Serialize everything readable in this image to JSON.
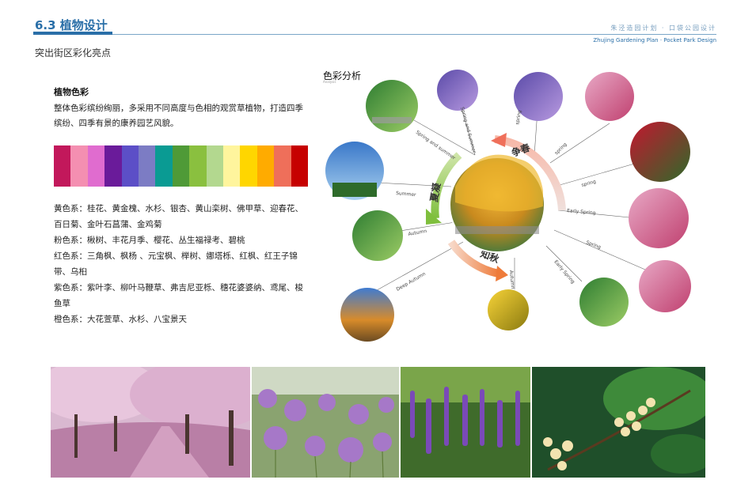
{
  "header": {
    "title": "6.3 植物设计",
    "brand_cn": "朱泾造园计划 · 口袋公园设计",
    "brand_en": "Zhujing Gardening Plan · Pocket Park Design"
  },
  "subtitle": "突出街区彩化亮点",
  "plant_color": {
    "heading": "植物色彩",
    "intro": "整体色彩缤纷绚丽，多采用不同高度与色相的观赏草植物，打造四季缤纷、四季有景的康养园艺风貌。",
    "swatches": [
      "#c2185b",
      "#f48fb1",
      "#e06ccf",
      "#6a1b9a",
      "#5c4fc7",
      "#7c7cc4",
      "#0a9b93",
      "#4f9a37",
      "#8ac03f",
      "#b3d88f",
      "#fff59d",
      "#ffd600",
      "#ffab00",
      "#ef6f5a",
      "#c60000"
    ]
  },
  "color_groups": [
    "黄色系：桂花、黄金槐、水杉、银杏、黄山栾树、佛甲草、迎春花、百日菊、金叶石菖蒲、金鸡菊",
    "粉色系：楸树、丰花月季、樱花、丛生福禄考、碧桃",
    "红色系：三角枫、枫杨 、元宝枫、榉树、娜塔栎、红枫、红王子锦带、乌桕",
    "紫色系：紫叶李、柳叶马鞭草、弗吉尼亚栎、穗花婆婆纳、鸢尾、梭鱼草",
    "橙色系：大花萱草、水杉、八宝景天"
  ],
  "analysis": {
    "title": "色彩分析",
    "subtitle": "Analysis",
    "seasons": {
      "spring": "争春",
      "summer": "夏凝",
      "autumn": "知秋"
    },
    "labels": [
      "Spring and summer",
      "Spring and Summer",
      "spring",
      "spring",
      "spring",
      "Early Spring",
      "Spring",
      "Early Spring",
      "Autumn",
      "Summer",
      "Autumn",
      "Deep Autumn"
    ]
  }
}
